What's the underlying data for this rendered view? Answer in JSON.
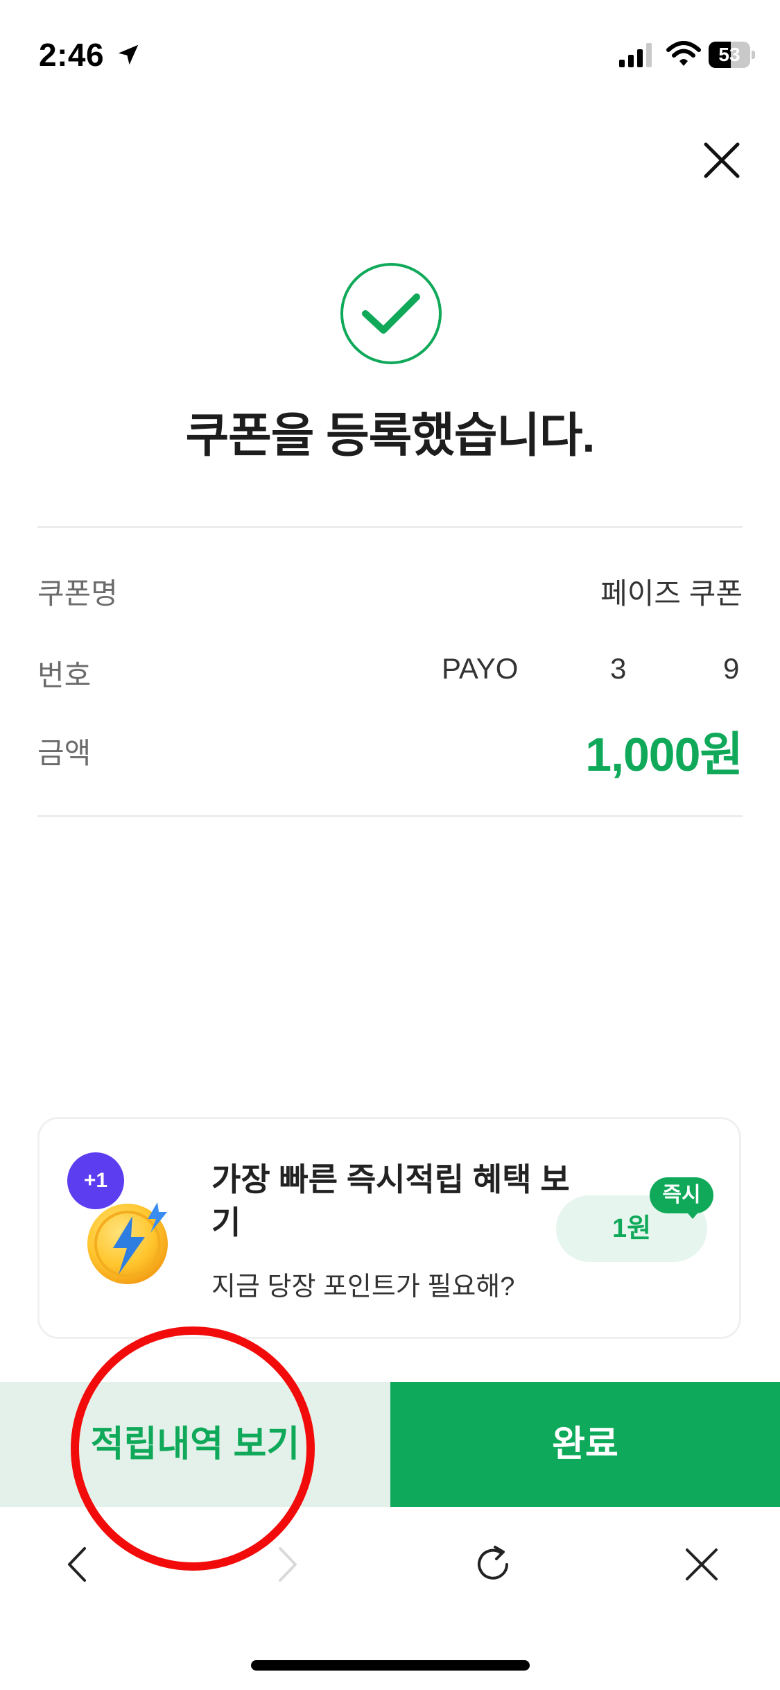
{
  "status_bar": {
    "time": "2:46",
    "battery_level": "53",
    "battery_fill_fraction": 0.53,
    "icons": [
      "location-arrow-icon",
      "cellular-signal-icon",
      "wifi-icon",
      "battery-icon"
    ]
  },
  "header": {
    "close_icon": "close-icon"
  },
  "result": {
    "icon": "check-circle-icon",
    "title": "쿠폰을 등록했습니다."
  },
  "details": {
    "name_label": "쿠폰명",
    "name_value": "페이즈 쿠폰",
    "number_label": "번호",
    "number_parts": [
      "PAYO",
      "3",
      "9"
    ],
    "amount_label": "금액",
    "amount_value": "1,000원"
  },
  "promo": {
    "badge": "+1",
    "icon": "lightning-coin-icon",
    "title": "가장 빠른 즉시적립 혜택 보기",
    "subtitle": "지금 당장 포인트가 필요해?",
    "reward": "1원",
    "reward_tag": "즉시"
  },
  "actions": {
    "history_label": "적립내역 보기",
    "done_label": "완료"
  },
  "browser_nav": {
    "icons": [
      "chevron-left-icon",
      "chevron-right-icon",
      "refresh-icon",
      "close-icon"
    ]
  },
  "colors": {
    "accent": "#10a95a",
    "accent_light": "#e4f1ea",
    "highlight": "#f20b0b",
    "badge_purple": "#5c3df0"
  }
}
